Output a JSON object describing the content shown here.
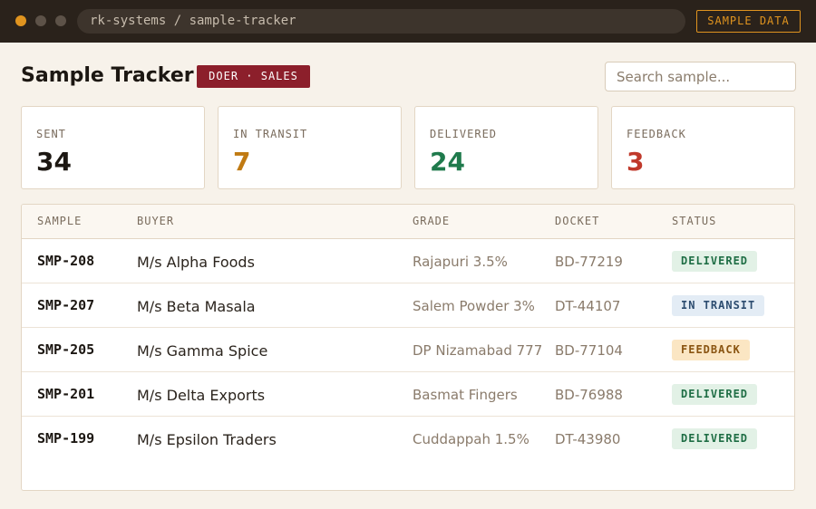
{
  "window": {
    "path": "rk-systems / sample-tracker",
    "tag": "SAMPLE DATA"
  },
  "header": {
    "title": "Sample Tracker",
    "role_badge": "DOER · SALES",
    "search_placeholder": "Search sample..."
  },
  "stats": [
    {
      "label": "SENT",
      "value": "34",
      "color": "#1c1712"
    },
    {
      "label": "IN TRANSIT",
      "value": "7",
      "color": "#c07a12"
    },
    {
      "label": "DELIVERED",
      "value": "24",
      "color": "#1f7a4c"
    },
    {
      "label": "FEEDBACK",
      "value": "3",
      "color": "#c0392b"
    }
  ],
  "table": {
    "columns": [
      "SAMPLE",
      "BUYER",
      "GRADE",
      "DOCKET",
      "STATUS"
    ],
    "rows": [
      {
        "sample": "SMP-208",
        "buyer": "M/s Alpha Foods",
        "grade": "Rajapuri 3.5%",
        "docket": "BD-77219",
        "status": "DELIVERED"
      },
      {
        "sample": "SMP-207",
        "buyer": "M/s Beta Masala",
        "grade": "Salem Powder 3%",
        "docket": "DT-44107",
        "status": "IN TRANSIT"
      },
      {
        "sample": "SMP-205",
        "buyer": "M/s Gamma Spice",
        "grade": "DP Nizamabad 777",
        "docket": "BD-77104",
        "status": "FEEDBACK"
      },
      {
        "sample": "SMP-201",
        "buyer": "M/s Delta Exports",
        "grade": "Basmat Fingers",
        "docket": "BD-76988",
        "status": "DELIVERED"
      },
      {
        "sample": "SMP-199",
        "buyer": "M/s Epsilon Traders",
        "grade": "Cuddappah 1.5%",
        "docket": "DT-43980",
        "status": "DELIVERED"
      }
    ]
  }
}
